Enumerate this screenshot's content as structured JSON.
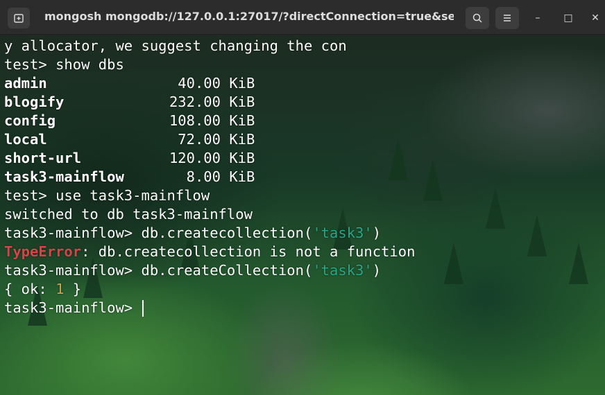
{
  "window": {
    "title": "mongosh mongodb://127.0.0.1:27017/?directConnection=true&serverSelectionTimeoutMS=2000",
    "title_visible": "mongosh mongodb://127.0.0.1:27017/?directConnection=true&se...",
    "new_tab_icon": "new-tab-icon",
    "search_icon": "search-icon",
    "menu_icon": "hamburger-menu-icon",
    "minimize_symbol": "–",
    "maximize_symbol": "□",
    "close_symbol": "✕"
  },
  "terminal": {
    "line_warning": "y allocator, we suggest changing the con",
    "prompt_test": "test> ",
    "cmd_show_dbs": "show dbs",
    "databases": [
      {
        "name": "admin",
        "size": "40.00",
        "unit": "KiB"
      },
      {
        "name": "blogify",
        "size": "232.00",
        "unit": "KiB"
      },
      {
        "name": "config",
        "size": "108.00",
        "unit": "KiB"
      },
      {
        "name": "local",
        "size": "72.00",
        "unit": "KiB"
      },
      {
        "name": "short-url",
        "size": "120.00",
        "unit": "KiB"
      },
      {
        "name": "task3-mainflow",
        "size": "8.00",
        "unit": "KiB"
      }
    ],
    "cmd_use": "use task3-mainflow",
    "switched_msg": "switched to db task3-mainflow",
    "prompt_db": "task3-mainflow> ",
    "cmd_create_wrong_pre": "db.createcollection(",
    "cmd_create_wrong_arg": "'task3'",
    "cmd_create_post": ")",
    "error_type": "TypeError",
    "error_msg": ": db.createcollection is not a function",
    "cmd_create_right_pre": "db.createCollection(",
    "cmd_create_right_arg": "'task3'",
    "result_pre": "{ ok: ",
    "result_val": "1",
    "result_post": " }",
    "prompt_final": "task3-mainflow> "
  },
  "colors": {
    "string": "#2aa68a",
    "number": "#c3a253",
    "error": "#d6444a",
    "titlebar": "#2c2c2c"
  }
}
